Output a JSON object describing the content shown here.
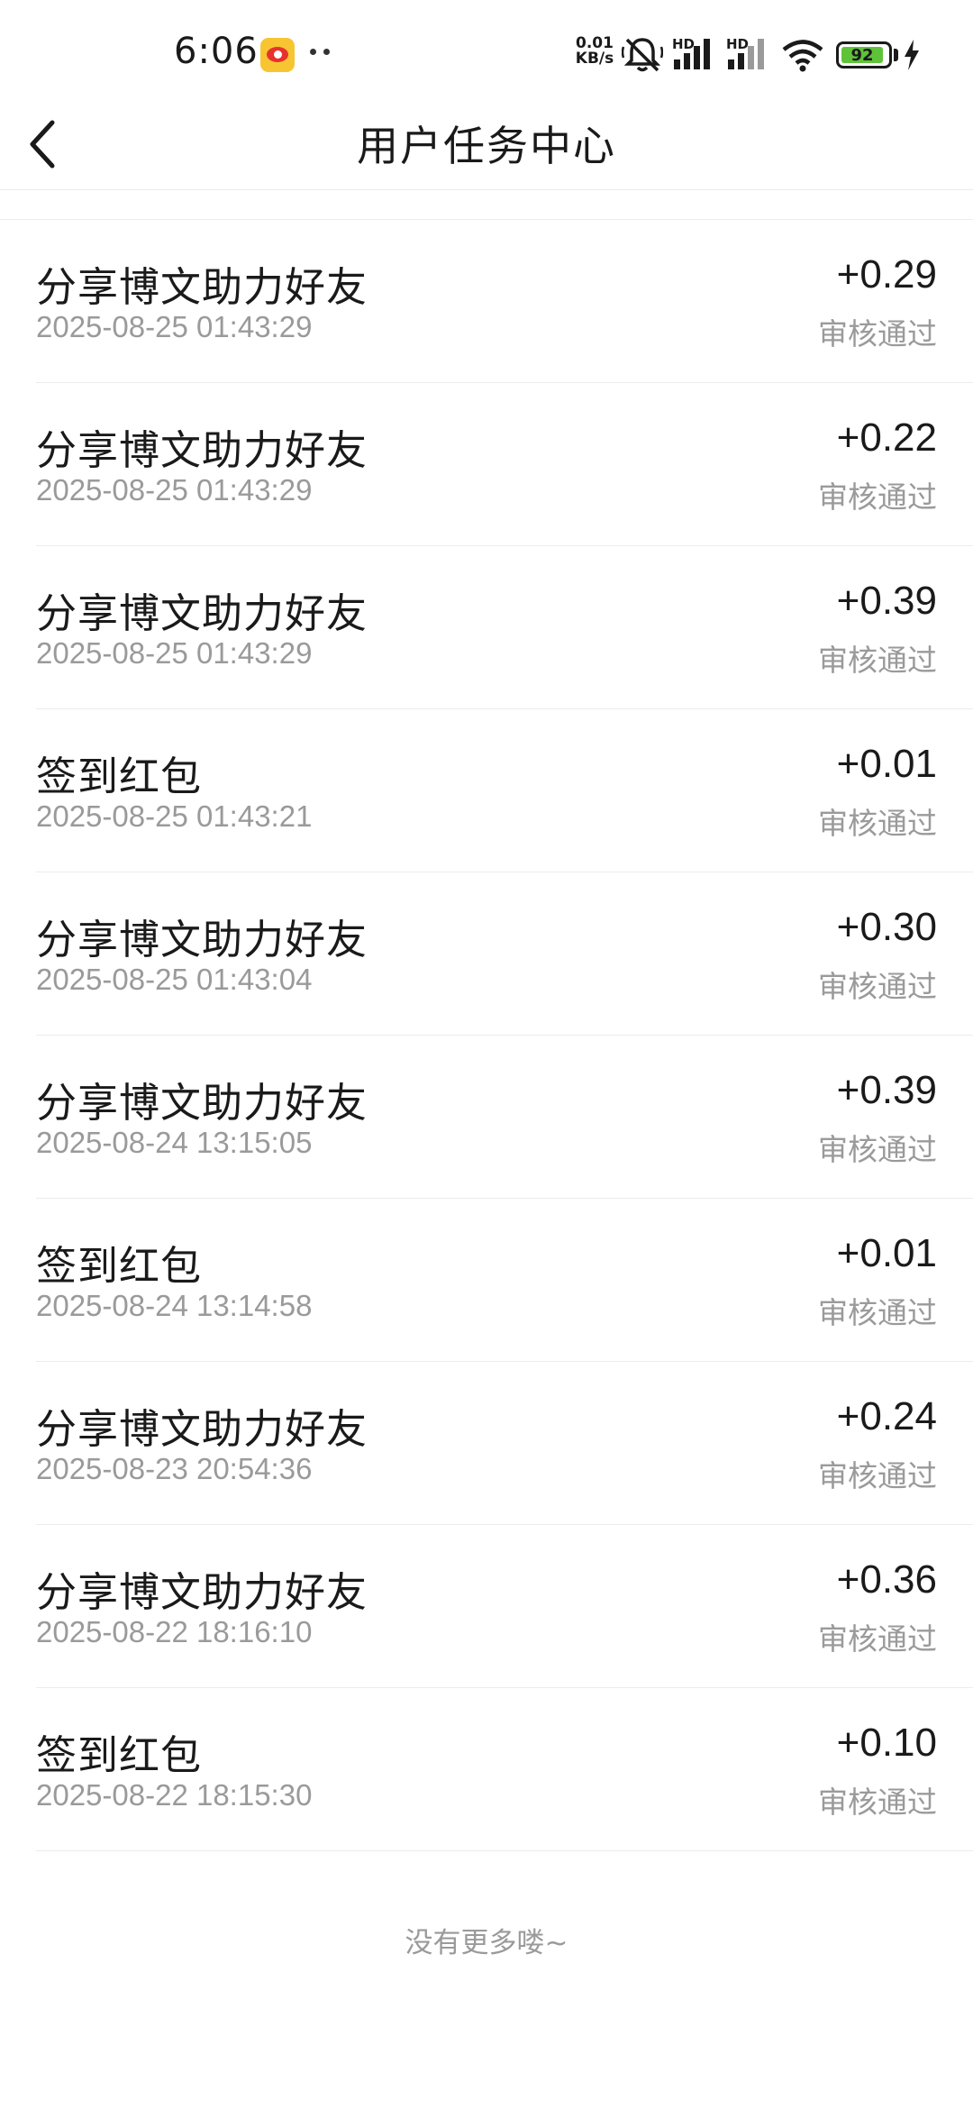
{
  "status_bar": {
    "time": "6:06",
    "net_speed_value": "0.01",
    "net_speed_unit": "KB/s",
    "hd1": "HD",
    "hd2": "HD",
    "battery": "92",
    "icons": [
      "weibo-app-icon",
      "more-dots-icon",
      "mute-bell-icon",
      "signal-icon",
      "signal-icon",
      "wifi-icon",
      "battery-icon",
      "charging-icon"
    ]
  },
  "header": {
    "title": "用户任务中心",
    "back_icon": "chevron-left-icon"
  },
  "colors": {
    "text_primary": "#1a1a1a",
    "text_secondary": "#9a9a9a",
    "divider": "#ececec",
    "battery_green": "#5fc33a",
    "weibo_yellow": "#f7c531",
    "weibo_red": "#e8322d"
  },
  "records": [
    {
      "title": "分享博文助力好友",
      "time": "2025-08-25 01:43:29",
      "amount": "+0.29",
      "status": "审核通过"
    },
    {
      "title": "分享博文助力好友",
      "time": "2025-08-25 01:43:29",
      "amount": "+0.22",
      "status": "审核通过"
    },
    {
      "title": "分享博文助力好友",
      "time": "2025-08-25 01:43:29",
      "amount": "+0.39",
      "status": "审核通过"
    },
    {
      "title": "签到红包",
      "time": "2025-08-25 01:43:21",
      "amount": "+0.01",
      "status": "审核通过"
    },
    {
      "title": "分享博文助力好友",
      "time": "2025-08-25 01:43:04",
      "amount": "+0.30",
      "status": "审核通过"
    },
    {
      "title": "分享博文助力好友",
      "time": "2025-08-24 13:15:05",
      "amount": "+0.39",
      "status": "审核通过"
    },
    {
      "title": "签到红包",
      "time": "2025-08-24 13:14:58",
      "amount": "+0.01",
      "status": "审核通过"
    },
    {
      "title": "分享博文助力好友",
      "time": "2025-08-23 20:54:36",
      "amount": "+0.24",
      "status": "审核通过"
    },
    {
      "title": "分享博文助力好友",
      "time": "2025-08-22 18:16:10",
      "amount": "+0.36",
      "status": "审核通过"
    },
    {
      "title": "签到红包",
      "time": "2025-08-22 18:15:30",
      "amount": "+0.10",
      "status": "审核通过"
    }
  ],
  "footer": {
    "no_more": "没有更多喽~"
  }
}
